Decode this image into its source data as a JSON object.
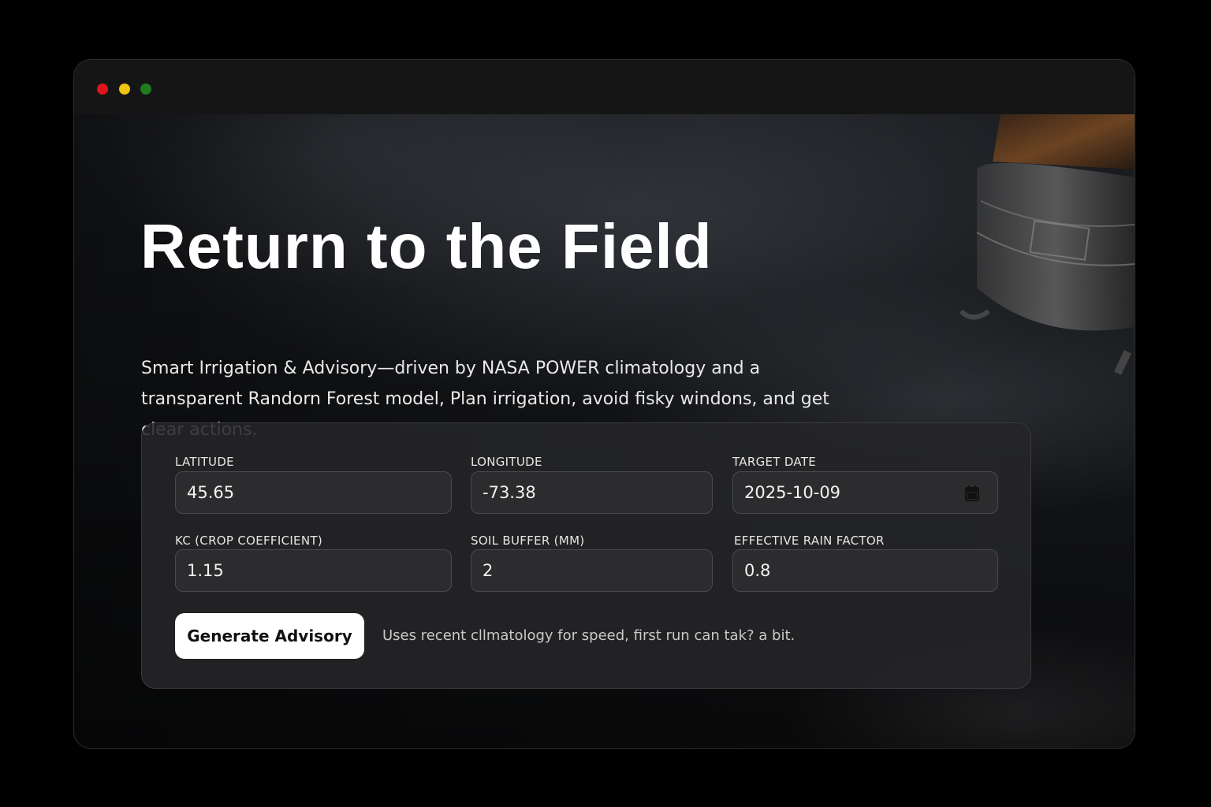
{
  "window": {
    "controls": [
      "close",
      "minimize",
      "maximize"
    ]
  },
  "hero": {
    "title": "Return to the Field",
    "subtitle": "Smart Irrigation & Advisory—driven by NASA POWER climatology and a transparent Randorn Forest model, Plan irrigation, avoid fisky windons, and get clear actions."
  },
  "form": {
    "latitude": {
      "label": "LATITUDE",
      "value": "45.65"
    },
    "longitude": {
      "label": "LONGITUDE",
      "value": "-73.38"
    },
    "target_date": {
      "label": "TARGET DATE",
      "value": "2025-10-09",
      "icon": "calendar-icon"
    },
    "kc": {
      "label": "KC (CROP COEFFICIENT)",
      "value": "1.15"
    },
    "soil_buffer": {
      "label": "SOIL BUFFER (MM)",
      "value": "2"
    },
    "rain_factor": {
      "label": "EFFECTIVE RAIN FACTOR",
      "value": "0.8"
    },
    "submit_label": "Generate Advisory",
    "hint": "Uses recent cllmatology for speed, first run can tak? a bit."
  },
  "colors": {
    "close": "#e0141a",
    "minimize": "#f1c40f",
    "maximize": "#1e7d1e",
    "button_bg": "#ffffff"
  }
}
